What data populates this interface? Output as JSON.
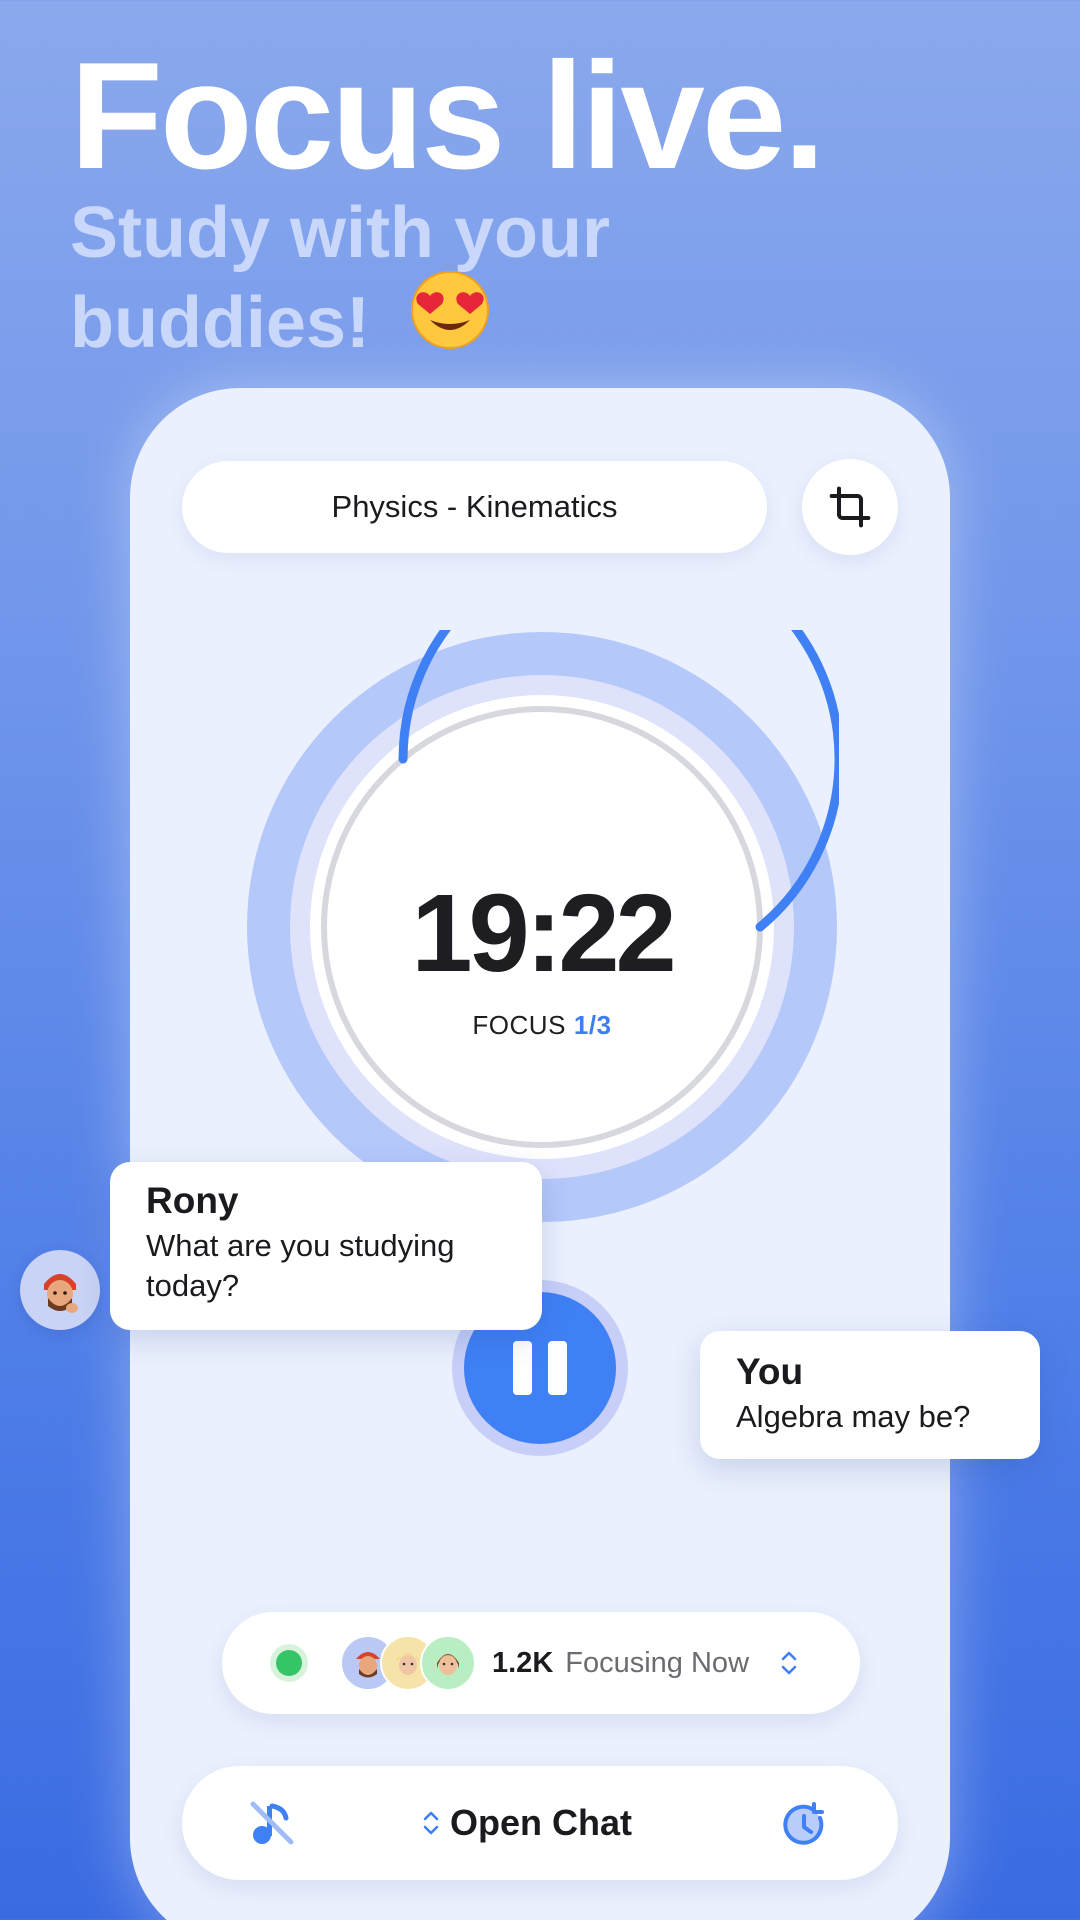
{
  "hero": {
    "headline": "Focus live.",
    "subline": "Study with your buddies!",
    "emoji": "smiling-face-with-heart-eyes"
  },
  "session": {
    "topic": "Physics - Kinematics",
    "timer": "19:22",
    "focus_label": "FOCUS",
    "focus_count": "1/3",
    "progress_fraction": 0.64
  },
  "chat": {
    "rony": {
      "name": "Rony",
      "message": "What are you studying\n today?"
    },
    "you": {
      "name": "You",
      "message": "Algebra may be?"
    }
  },
  "focusing": {
    "count": "1.2K",
    "label": "Focusing Now"
  },
  "bottom_bar": {
    "open_chat": "Open Chat"
  },
  "colors": {
    "accent": "#3f80f5",
    "online": "#35c566",
    "ring_outer": "#b5c8fa",
    "ring_mid": "#dfe2fb"
  },
  "icons": [
    "crop-icon",
    "pause-icon",
    "music-off-icon",
    "chevron-up-down-icon",
    "history-icon",
    "online-status-dot"
  ]
}
